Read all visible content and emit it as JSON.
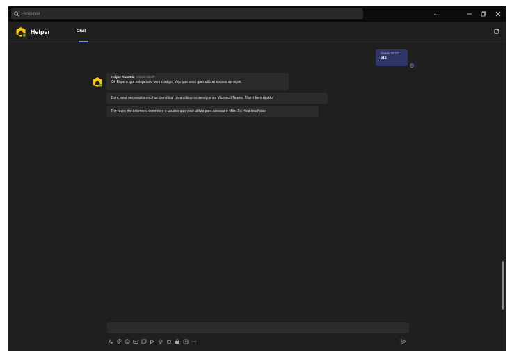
{
  "titlebar": {
    "search_placeholder": "Pesquisar",
    "controls": [
      "more",
      "minimize",
      "restore",
      "close"
    ]
  },
  "app": {
    "name": "Helper",
    "tabs": [
      {
        "label": "Chat",
        "active": true
      }
    ]
  },
  "messages": {
    "sent": {
      "time": "Ontem 08:27",
      "text": "olá"
    },
    "bot": {
      "sender": "Helper Run2Biz",
      "time": "Ontem 08:27",
      "lines": [
        "Oi! Espero que esteja tudo bem contigo. Vejo que você quer utilizar nossos serviços.",
        "Bom, será necessário você se identificar para utilizar os serviços via Microsoft Teams. Mas é bem rápido!",
        "Por favor, me informe o domínio e o usuário que você utiliza para acessar o 4Biz. Ex: 4biz.local\\joao"
      ]
    }
  },
  "compose": {
    "placeholder": "",
    "tools": [
      "format-icon",
      "attach-icon",
      "emoji-icon",
      "gif-icon",
      "sticker-icon",
      "praise-icon",
      "bulb-icon",
      "loop-icon",
      "approvals-icon",
      "apps-icon",
      "more-icon"
    ]
  },
  "colors": {
    "background": "#1f1f1f",
    "titlebar": "#0b0b0b",
    "bubble": "#2b2b2b",
    "sent_bubble": "#2f3566",
    "accent": "#7f85f5",
    "logo_yellow": "#f5c518",
    "status_green": "#6bb700"
  }
}
